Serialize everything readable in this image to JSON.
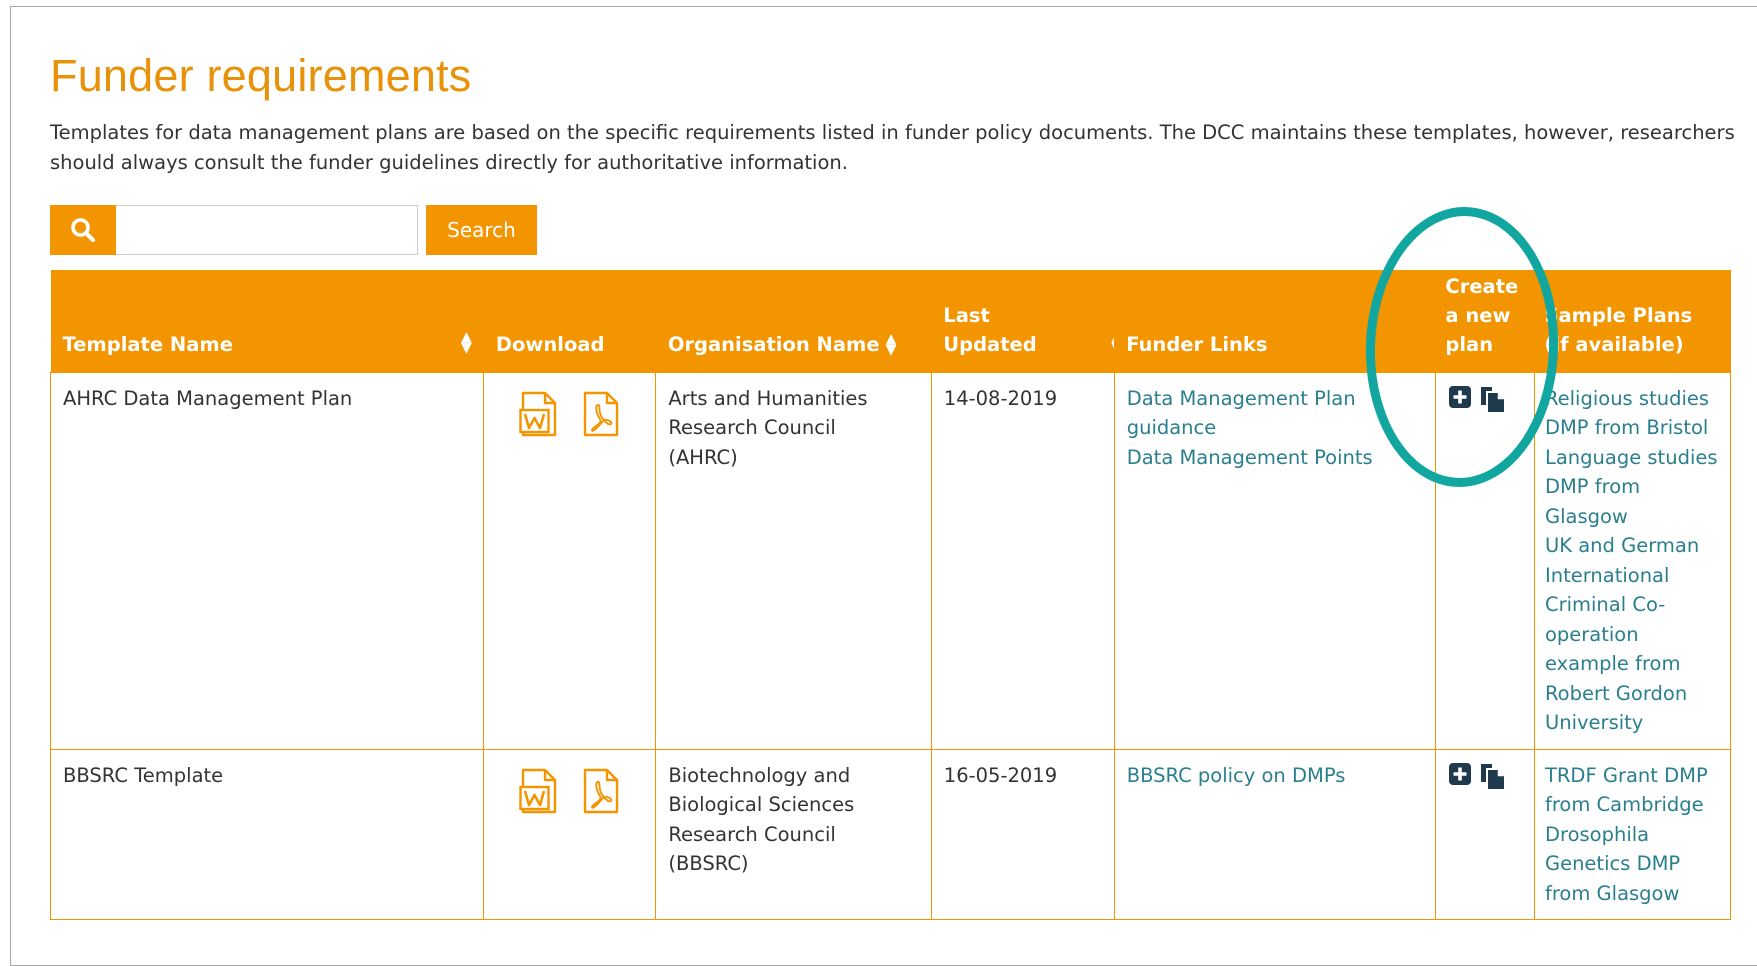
{
  "page": {
    "title": "Funder requirements",
    "intro": "Templates for data management plans are based on the specific requirements listed in funder policy documents. The DCC maintains these templates, however, researchers should always consult the funder guidelines directly for authoritative information."
  },
  "search": {
    "button_label": "Search",
    "value": "",
    "placeholder": ""
  },
  "table": {
    "headers": {
      "template_name": "Template Name",
      "download": "Download",
      "organisation_name": "Organisation Name",
      "last_updated": [
        "Last",
        "Updated"
      ],
      "funder_links": "Funder Links",
      "create_plan": [
        "Create",
        "a new",
        "plan"
      ],
      "sample_plans": [
        "Sample Plans",
        "(if available)"
      ]
    },
    "rows": [
      {
        "template_name": "AHRC Data Management Plan",
        "organisation": [
          "Arts and Humanities",
          "Research Council",
          "(AHRC)"
        ],
        "last_updated": "14-08-2019",
        "funder_links": [
          "Data Management Plan guidance",
          "Data Management Points"
        ],
        "sample_plans": [
          "Religious studies DMP from Bristol",
          "Language studies DMP from Glasgow",
          "UK and German International Criminal Co-operation example from Robert Gordon University"
        ]
      },
      {
        "template_name": "BBSRC Template",
        "organisation": [
          "Biotechnology and",
          "Biological Sciences",
          "Research Council",
          "(BBSRC)"
        ],
        "last_updated": "16-05-2019",
        "funder_links": [
          "BBSRC policy on DMPs"
        ],
        "sample_plans": [
          "TRDF Grant DMP from Cambridge",
          "Drosophila Genetics DMP from Glasgow"
        ]
      }
    ]
  },
  "icons": {
    "search": "search-icon",
    "word": "word-document-icon",
    "pdf": "pdf-document-icon",
    "create": "plus-square-icon",
    "copy": "copy-icon"
  },
  "colors": {
    "accent": "#f39500",
    "title": "#e8920a",
    "link": "#2a7f8f",
    "highlight": "#11a6a0"
  }
}
